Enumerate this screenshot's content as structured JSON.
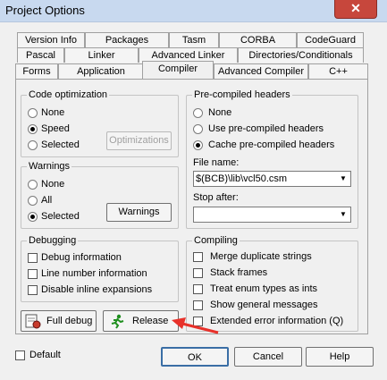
{
  "window": {
    "title": "Project Options",
    "close_glyph": "✕"
  },
  "tabs": {
    "row1": [
      "Version Info",
      "Packages",
      "Tasm",
      "CORBA",
      "CodeGuard"
    ],
    "row2": [
      "Pascal",
      "Linker",
      "Advanced Linker",
      "Directories/Conditionals"
    ],
    "row3": [
      "Forms",
      "Application",
      "Compiler",
      "Advanced Compiler",
      "C++"
    ],
    "active": "Compiler"
  },
  "code_optimization": {
    "legend": "Code optimization",
    "options": [
      "None",
      "Speed",
      "Selected"
    ],
    "selected": "Speed",
    "optimizations_button": "Optimizations"
  },
  "warnings": {
    "legend": "Warnings",
    "options": [
      "None",
      "All",
      "Selected"
    ],
    "selected": "Selected",
    "warnings_button": "Warnings"
  },
  "debugging": {
    "legend": "Debugging",
    "items": [
      "Debug information",
      "Line number information",
      "Disable inline expansions"
    ]
  },
  "precompiled": {
    "legend": "Pre-compiled headers",
    "options": [
      "None",
      "Use pre-compiled headers",
      "Cache pre-compiled headers"
    ],
    "selected": "Cache pre-compiled headers",
    "file_name_label": "File name:",
    "file_name_value": "$(BCB)\\lib\\vcl50.csm",
    "stop_after_label": "Stop after:",
    "stop_after_value": ""
  },
  "compiling": {
    "legend": "Compiling",
    "items": [
      "Merge duplicate strings",
      "Stack frames",
      "Treat enum types as ints",
      "Show general messages",
      "Extended error information (Q)"
    ]
  },
  "preset_buttons": {
    "full_debug": "Full debug",
    "release": "Release"
  },
  "footer": {
    "default_label": "Default",
    "ok": "OK",
    "cancel": "Cancel",
    "help": "Help"
  },
  "accent": {
    "annotation_arrow": "#e8312a",
    "title_bar": "#c8d9ef"
  }
}
